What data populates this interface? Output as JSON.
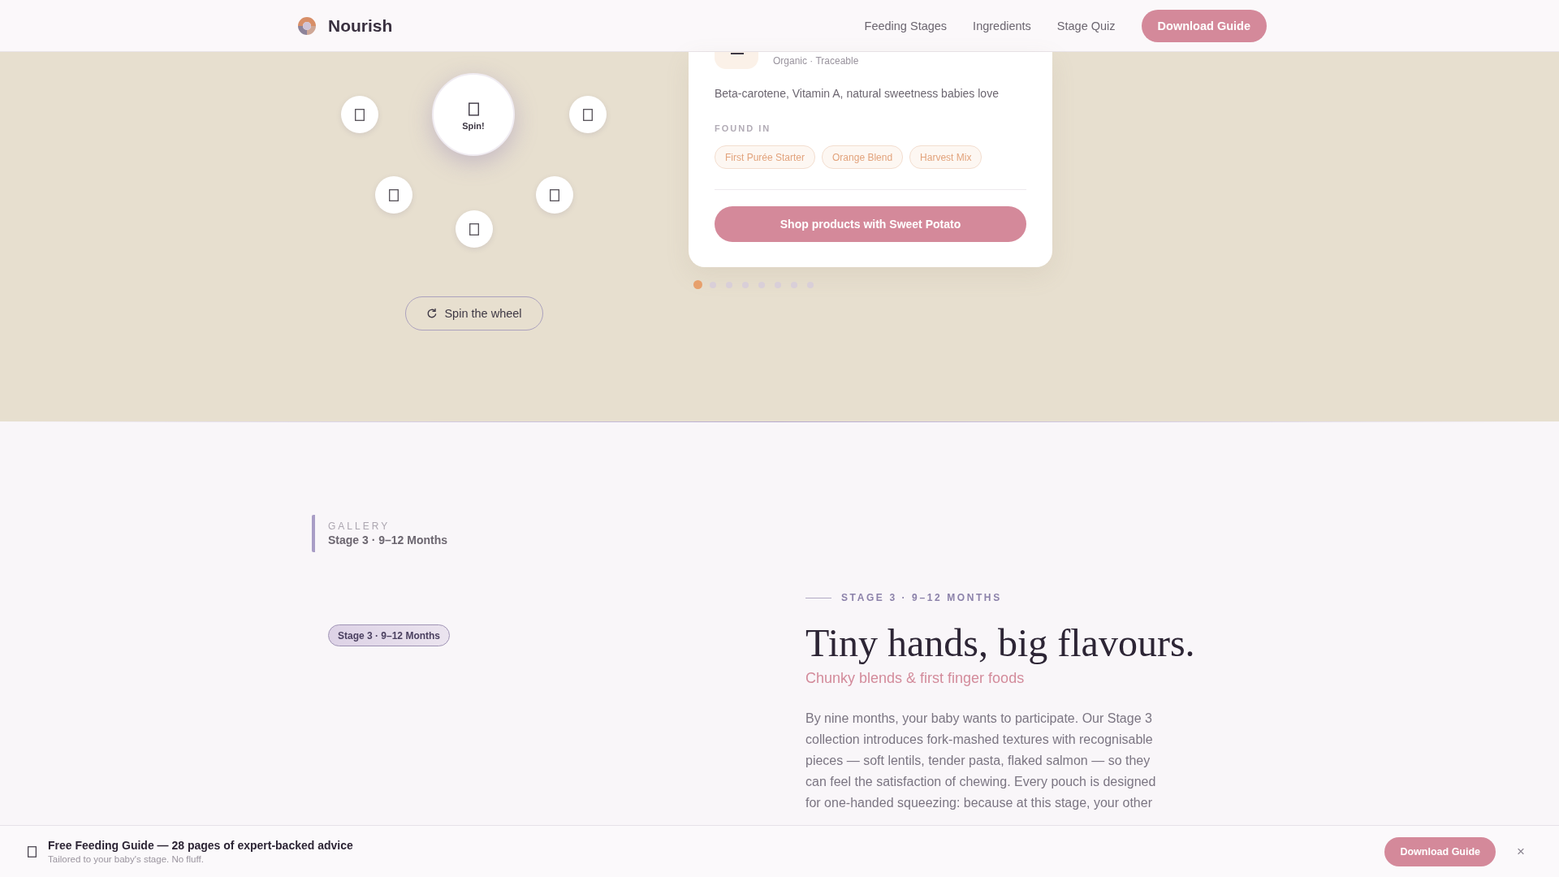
{
  "nav": {
    "brand": "Nourish",
    "links": [
      {
        "label": "Feeding Stages"
      },
      {
        "label": "Ingredients"
      },
      {
        "label": "Stage Quiz"
      }
    ],
    "cta": "Download Guide"
  },
  "wheel": {
    "center_label": "Spin!",
    "spin_button": "Spin the wheel"
  },
  "ingredient_card": {
    "meta": "Organic · Traceable",
    "description": "Beta-carotene, Vitamin A, natural sweetness babies love",
    "found_in_label": "FOUND IN",
    "products": [
      "First Purée Starter",
      "Orange Blend",
      "Harvest Mix"
    ],
    "shop_button": "Shop products with Sweet Potato"
  },
  "carousel_dots": [
    {
      "selected": true
    },
    {
      "selected": false
    },
    {
      "selected": false
    },
    {
      "selected": false
    },
    {
      "selected": false
    },
    {
      "selected": false
    },
    {
      "selected": false
    },
    {
      "selected": false
    }
  ],
  "gallery": {
    "eyebrow": "GALLERY",
    "title": "Stage 3 · 9–12 Months"
  },
  "stage": {
    "badge": "Stage 3 · 9–12 Months",
    "eyebrow": "STAGE 3 · 9–12 MONTHS",
    "heading": "Tiny hands, big flavours.",
    "subheading": "Chunky blends & first finger foods",
    "body": "By nine months, your baby wants to participate. Our Stage 3 collection introduces fork-mashed textures with recognisable pieces — soft lentils, tender pasta, flaked salmon — so they can feel the satisfaction of chewing. Every pouch is designed for one-handed squeezing: because at this stage, your other"
  },
  "guide_banner": {
    "title": "Free Feeding Guide — 28 pages of expert-backed advice",
    "subtitle": "Tailored to your baby's stage. No fluff.",
    "button": "Download Guide",
    "close": "×"
  }
}
